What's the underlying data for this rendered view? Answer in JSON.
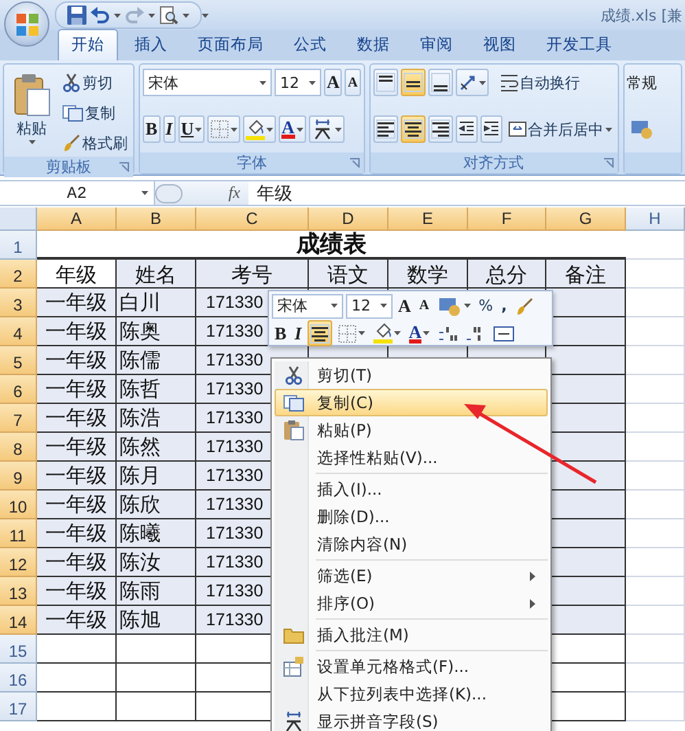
{
  "title_bar": {
    "file_title": "成绩.xls [兼"
  },
  "tabs": [
    {
      "label": "开始",
      "selected": true
    },
    {
      "label": "插入",
      "selected": false
    },
    {
      "label": "页面布局",
      "selected": false
    },
    {
      "label": "公式",
      "selected": false
    },
    {
      "label": "数据",
      "selected": false
    },
    {
      "label": "审阅",
      "selected": false
    },
    {
      "label": "视图",
      "selected": false
    },
    {
      "label": "开发工具",
      "selected": false
    }
  ],
  "ribbon": {
    "groups": [
      {
        "kind": "clipboard",
        "label": "剪贴板",
        "paste": "粘贴",
        "items": [
          "剪切",
          "复制",
          "格式刷"
        ]
      },
      {
        "kind": "font",
        "label": "字体",
        "font": "宋体",
        "size": "12",
        "grow_font": "A",
        "shrink_font": "A",
        "bold": "B",
        "italic": "I",
        "underline": "U",
        "font_color": "A"
      },
      {
        "kind": "alignment",
        "label": "对齐方式",
        "vertical_align": [
          {
            "selected": false
          },
          {
            "selected": true
          },
          {
            "selected": false
          }
        ],
        "horizontal_align": [
          {
            "selected": false
          },
          {
            "selected": true
          },
          {
            "selected": false
          }
        ],
        "wrap": "自动换行",
        "merge": "合并后居中"
      },
      {
        "kind": "number",
        "format": "常规"
      }
    ]
  },
  "formula_bar": {
    "name_box": "A2",
    "function_label": "fx",
    "value": "年级"
  },
  "sheet": {
    "columns": [
      {
        "label": "A",
        "selected": true
      },
      {
        "label": "B",
        "selected": true
      },
      {
        "label": "C",
        "selected": true
      },
      {
        "label": "D",
        "selected": true
      },
      {
        "label": "E",
        "selected": true
      },
      {
        "label": "F",
        "selected": true
      },
      {
        "label": "G",
        "selected": true
      },
      {
        "label": "H",
        "selected": false
      }
    ],
    "rows": [
      {
        "label": "1",
        "selected": false,
        "kind": "title",
        "title": "成绩表"
      },
      {
        "label": "2",
        "selected": true,
        "kind": "data",
        "cells": [
          "年级",
          "姓名",
          "考号",
          "语文",
          "数学",
          "总分",
          "备注"
        ]
      },
      {
        "label": "3",
        "selected": true,
        "kind": "data",
        "cells": [
          "一年级",
          "白川",
          "171330"
        ]
      },
      {
        "label": "4",
        "selected": true,
        "kind": "data",
        "cells": [
          "一年级",
          "陈奥",
          "171330"
        ]
      },
      {
        "label": "5",
        "selected": true,
        "kind": "data",
        "cells": [
          "一年级",
          "陈儒",
          "171330"
        ]
      },
      {
        "label": "6",
        "selected": true,
        "kind": "data",
        "cells": [
          "一年级",
          "陈哲",
          "171330"
        ]
      },
      {
        "label": "7",
        "selected": true,
        "kind": "data",
        "cells": [
          "一年级",
          "陈浩",
          "171330"
        ]
      },
      {
        "label": "8",
        "selected": true,
        "kind": "data",
        "cells": [
          "一年级",
          "陈然",
          "171330"
        ]
      },
      {
        "label": "9",
        "selected": true,
        "kind": "data",
        "cells": [
          "一年级",
          "陈月",
          "171330"
        ]
      },
      {
        "label": "10",
        "selected": true,
        "kind": "data",
        "cells": [
          "一年级",
          "陈欣",
          "171330"
        ]
      },
      {
        "label": "11",
        "selected": true,
        "kind": "data",
        "cells": [
          "一年级",
          "陈曦",
          "171330"
        ]
      },
      {
        "label": "12",
        "selected": true,
        "kind": "data",
        "cells": [
          "一年级",
          "陈汝",
          "171330"
        ]
      },
      {
        "label": "13",
        "selected": true,
        "kind": "data",
        "cells": [
          "一年级",
          "陈雨",
          "171330"
        ]
      },
      {
        "label": "14",
        "selected": true,
        "kind": "data",
        "cells": [
          "一年级",
          "陈旭",
          "171330"
        ]
      },
      {
        "label": "15",
        "selected": false,
        "kind": "data"
      },
      {
        "label": "16",
        "selected": false,
        "kind": "data"
      },
      {
        "label": "17",
        "selected": false,
        "kind": "data"
      }
    ]
  },
  "mini_toolbar": {
    "font": "宋体",
    "size": "12",
    "grow_font": "A",
    "shrink_font": "A",
    "percent": "%",
    "comma": ",",
    "bold": "B",
    "italic": "I",
    "align_center_selected": true,
    "font_color": "A"
  },
  "context_menu": {
    "items": [
      {
        "kind": "item",
        "label": "剪切(T)",
        "selected": false,
        "submenu": false
      },
      {
        "kind": "item",
        "label": "复制(C)",
        "selected": true,
        "submenu": false
      },
      {
        "kind": "item",
        "label": "粘贴(P)",
        "selected": false,
        "submenu": false
      },
      {
        "kind": "item",
        "label": "选择性粘贴(V)...",
        "selected": false,
        "submenu": false
      },
      {
        "kind": "separator"
      },
      {
        "kind": "item",
        "label": "插入(I)...",
        "selected": false,
        "submenu": false
      },
      {
        "kind": "item",
        "label": "删除(D)...",
        "selected": false,
        "submenu": false
      },
      {
        "kind": "item",
        "label": "清除内容(N)",
        "selected": false,
        "submenu": false
      },
      {
        "kind": "separator"
      },
      {
        "kind": "item",
        "label": "筛选(E)",
        "selected": false,
        "submenu": true
      },
      {
        "kind": "item",
        "label": "排序(O)",
        "selected": false,
        "submenu": true
      },
      {
        "kind": "separator"
      },
      {
        "kind": "item",
        "label": "插入批注(M)",
        "selected": false,
        "submenu": false
      },
      {
        "kind": "separator"
      },
      {
        "kind": "item",
        "label": "设置单元格格式(F)...",
        "selected": false,
        "submenu": false
      },
      {
        "kind": "item",
        "label": "从下拉列表中选择(K)...",
        "selected": false,
        "submenu": false
      },
      {
        "kind": "item",
        "label": "显示拼音字段(S)",
        "selected": false,
        "submenu": false
      }
    ]
  }
}
